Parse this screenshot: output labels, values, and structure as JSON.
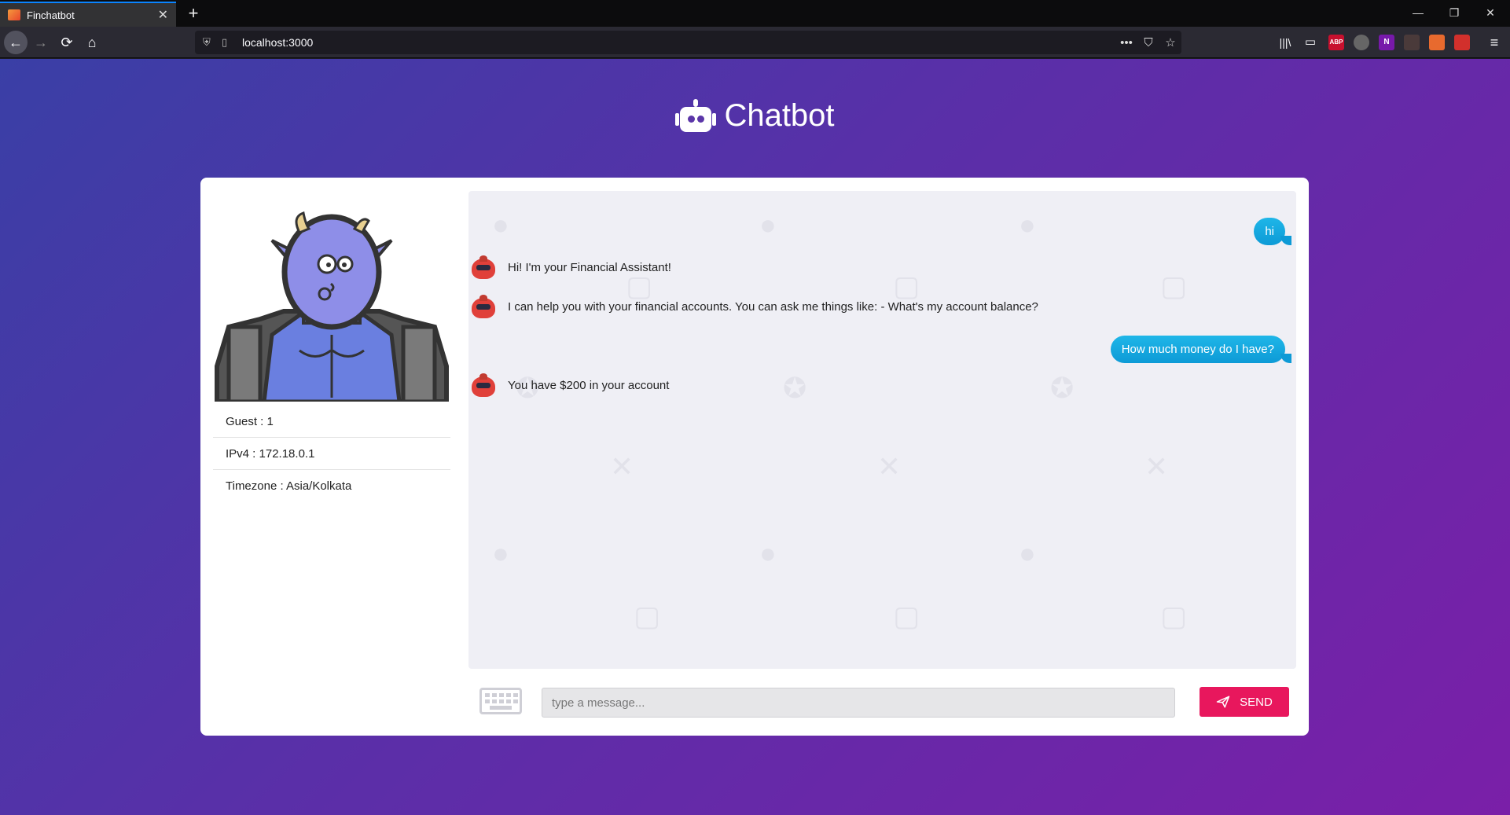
{
  "browser": {
    "tab_title": "Finchatbot",
    "tab_close": "✕",
    "new_tab": "+",
    "url": "localhost:3000",
    "controls": {
      "minimize": "—",
      "restore": "❐",
      "close": "✕"
    },
    "nav_icons": {
      "back": "←",
      "forward": "→",
      "reload": "⟳",
      "home": "⌂"
    },
    "url_icons": {
      "more": "•••",
      "pocket": "⛉",
      "bookmark": "☆"
    },
    "toolbar_icons": {
      "library": "|||\\",
      "sidebar": "▭",
      "menu": "≡"
    },
    "extensions": [
      "ABP",
      "N"
    ]
  },
  "header": {
    "title": "Chatbot"
  },
  "guest_info": {
    "guest": "Guest : 1",
    "ipv4": "IPv4 : 172.18.0.1",
    "timezone": "Timezone : Asia/Kolkata"
  },
  "messages": [
    {
      "from": "user",
      "text": "hi"
    },
    {
      "from": "bot",
      "text": "Hi! I'm your Financial Assistant!"
    },
    {
      "from": "bot",
      "text": "I can help you with your financial accounts. You can ask me things like: - What's my account balance?"
    },
    {
      "from": "user",
      "text": "How much money do I have?"
    },
    {
      "from": "bot",
      "text": "You have $200 in your account"
    }
  ],
  "composer": {
    "placeholder": "type a message...",
    "send_label": "SEND"
  },
  "colors": {
    "send": "#e8175d",
    "user_bubble": "#0d9ad6",
    "bg_start": "#3a3fa6",
    "bg_end": "#7a1fa8"
  }
}
